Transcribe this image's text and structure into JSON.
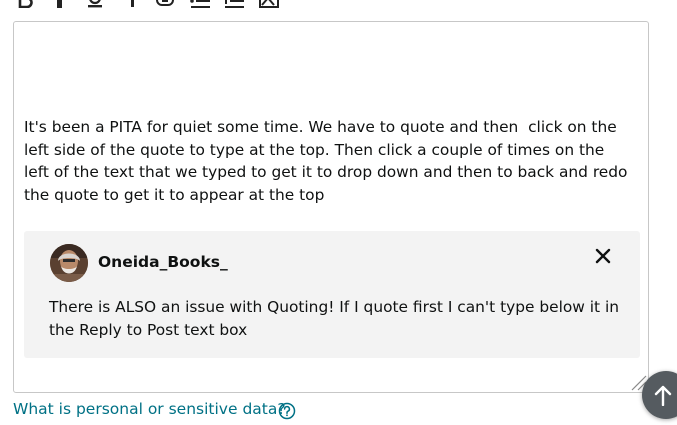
{
  "toolbar": {
    "icons": [
      "bold-icon",
      "italic-icon",
      "underline-icon",
      "strikethrough-icon",
      "link-icon",
      "bulleted-list-icon",
      "numbered-list-icon",
      "image-icon"
    ]
  },
  "editor": {
    "body_text": "It's been a PITA for quiet some time. We have to quote and then  click on the left side of the quote to type at the top. Then click a couple of times on the left of the text that we typed to get it to drop down and then to back and redo the quote to get it to appear at the top",
    "quote": {
      "author": "Oneida_Books_",
      "text": "There is ALSO an issue with Quoting! If I quote first I can't type below it in the Reply to Post text box"
    }
  },
  "help": {
    "link_text": "What is personal or sensitive data?"
  },
  "colors": {
    "link": "#007185",
    "quote_bg": "#f3f3f3",
    "border": "#c7c7c7",
    "scroll_button": "#555b60"
  }
}
